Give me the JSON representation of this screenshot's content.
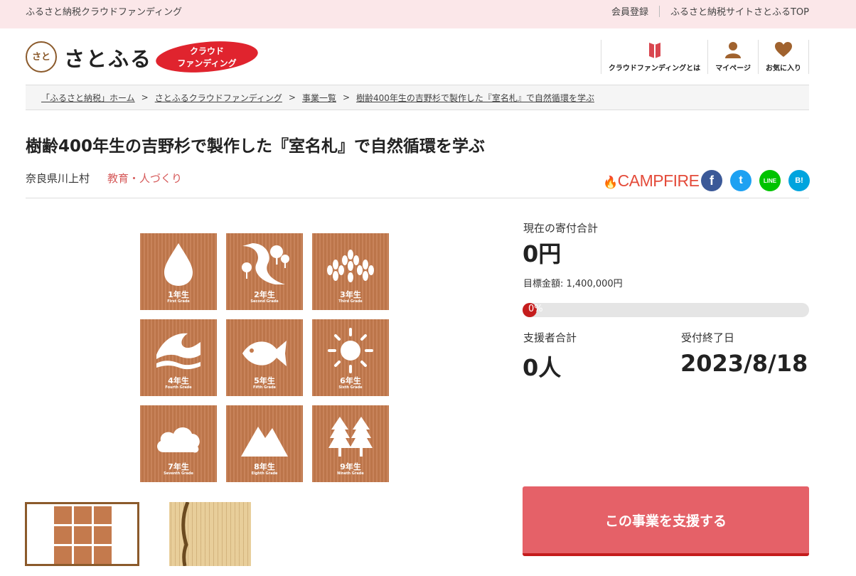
{
  "topbar": {
    "site_name": "ふるさと納税クラウドファンディング",
    "member_register": "会員登録",
    "top_link": "ふるさと納税サイトさとふるTOP"
  },
  "header": {
    "logo_mark": "さと",
    "logo_text": "さとふる",
    "badge_line1": "クラウド",
    "badge_line2": "ファンディング",
    "nav": [
      {
        "label": "クラウドファンディングとは",
        "icon": "book-icon"
      },
      {
        "label": "マイページ",
        "icon": "user-icon"
      },
      {
        "label": "お気に入り",
        "icon": "heart-icon"
      }
    ]
  },
  "breadcrumb": [
    "「ふるさと納税」ホーム",
    "さとふるクラウドファンディング",
    "事業一覧",
    "樹齢400年生の吉野杉で製作した『室名札』で自然循環を学ぶ"
  ],
  "project": {
    "title": "樹齢400年生の吉野杉で製作した『室名札』で自然循環を学ぶ",
    "location": "奈良県川上村",
    "category": "教育・人づくり",
    "partner": "CAMPFIRE"
  },
  "share": [
    {
      "name": "facebook",
      "glyph": "f",
      "color": "#3b5998"
    },
    {
      "name": "twitter",
      "glyph": "t",
      "color": "#1da1f2"
    },
    {
      "name": "line",
      "glyph": "LINE",
      "color": "#00c300"
    },
    {
      "name": "hatena",
      "glyph": "B!",
      "color": "#00a4de"
    }
  ],
  "tiles": [
    {
      "grade": "1年生",
      "sub": "First Grade",
      "icon": "water-drop-icon"
    },
    {
      "grade": "2年生",
      "sub": "Second Grade",
      "icon": "river-icon"
    },
    {
      "grade": "3年生",
      "sub": "Third Grade",
      "icon": "wheat-icon"
    },
    {
      "grade": "4年生",
      "sub": "Fourth Grade",
      "icon": "wave-icon"
    },
    {
      "grade": "5年生",
      "sub": "Fifth Grade",
      "icon": "fish-icon"
    },
    {
      "grade": "6年生",
      "sub": "Sixth Grade",
      "icon": "sun-icon"
    },
    {
      "grade": "7年生",
      "sub": "Seventh Grade",
      "icon": "cloud-icon"
    },
    {
      "grade": "8年生",
      "sub": "Eighth Grade",
      "icon": "mountain-icon"
    },
    {
      "grade": "9年生",
      "sub": "Nineth Grade",
      "icon": "tree-icon"
    }
  ],
  "funding": {
    "current_label": "現在の寄付合計",
    "current_amount": "0円",
    "goal_text": "目標金額: 1,400,000円",
    "progress_text": "0%",
    "progress_percent": 0,
    "supporters_label": "支援者合計",
    "supporters_value": "0人",
    "end_label": "受付終了日",
    "end_value": "2023/8/18",
    "support_button": "この事業を支援する"
  },
  "colors": {
    "accent": "#e56168",
    "topbar_bg": "#fbe7e9",
    "category": "#d65a5a",
    "wood": "#c47a4d"
  }
}
